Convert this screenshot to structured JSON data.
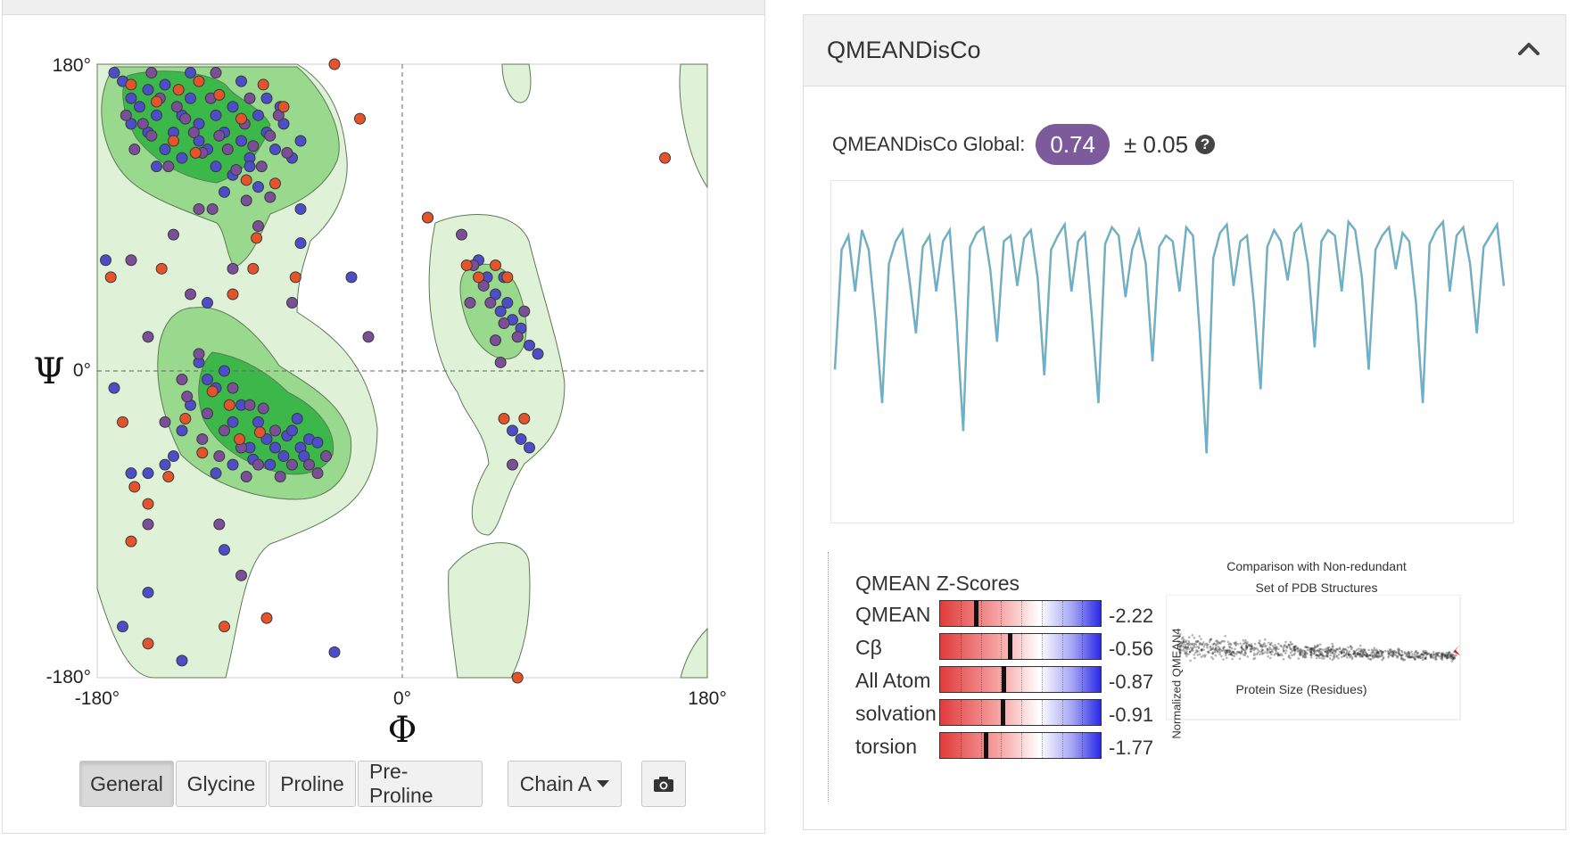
{
  "ramachandran": {
    "x_axis_symbol": "Φ",
    "y_axis_symbol": "Ψ",
    "x_ticks": [
      "-180°",
      "0°",
      "180°"
    ],
    "y_ticks": [
      "180°",
      "0°",
      "-180°"
    ],
    "colors": {
      "region_light": "#dff2d8",
      "region_mid": "#99d98d",
      "region_dark": "#3cb84a",
      "point_blue": "#4d4dc8",
      "point_purple": "#7a4f97",
      "point_orange": "#e5532b"
    },
    "buttons": [
      {
        "label": "General",
        "active": true
      },
      {
        "label": "Glycine",
        "active": false
      },
      {
        "label": "Proline",
        "active": false
      },
      {
        "label": "Pre-Proline",
        "active": false
      }
    ],
    "chain_dropdown": "Chain A",
    "camera_icon": "camera-icon"
  },
  "qmeandisco": {
    "panel_title": "QMEANDisCo",
    "collapse_icon": "chevron-up-icon",
    "global_label": "QMEANDisCo Global:",
    "global_value": "0.74",
    "global_error": "± 0.05",
    "help_icon": "question-circle-icon",
    "badge_color": "#7c5a9b"
  },
  "zscores": {
    "title": "QMEAN Z-Scores",
    "items": [
      {
        "label": "QMEAN",
        "value": "-2.22",
        "z": -2.22
      },
      {
        "label": "Cβ",
        "value": "-0.56",
        "z": -0.56
      },
      {
        "label": "All Atom",
        "value": "-0.87",
        "z": -0.87
      },
      {
        "label": "solvation",
        "value": "-0.91",
        "z": -0.91
      },
      {
        "label": "torsion",
        "value": "-1.77",
        "z": -1.77
      }
    ]
  },
  "comparison": {
    "title_line1": "Comparison with Non-redundant",
    "title_line2": "Set of PDB Structures",
    "xlabel": "Protein Size (Residues)",
    "ylabel": "Normalized QMEAN4"
  },
  "chart_data": [
    {
      "type": "scatter",
      "x_symbol": "Φ",
      "y_symbol": "Ψ",
      "xlim": [
        -180,
        180
      ],
      "ylim": [
        -180,
        180
      ],
      "grid": false,
      "series": [
        {
          "values": [
            [
              -165,
              170
            ],
            [
              -160,
              160
            ],
            [
              -155,
              155
            ],
            [
              -150,
              165
            ],
            [
              -145,
              150
            ],
            [
              -140,
              168
            ],
            [
              -135,
              140
            ],
            [
              -130,
              150
            ],
            [
              -125,
              160
            ],
            [
              -120,
              145
            ],
            [
              -115,
              130
            ],
            [
              -110,
              150
            ],
            [
              -105,
              140
            ],
            [
              -100,
              155
            ],
            [
              -95,
              135
            ],
            [
              -90,
              125
            ],
            [
              -85,
              150
            ],
            [
              -80,
              140
            ],
            [
              -75,
              130
            ],
            [
              -70,
              145
            ],
            [
              -65,
              125
            ],
            [
              -60,
              135
            ],
            [
              -150,
              140
            ],
            [
              -140,
              130
            ],
            [
              -130,
              125
            ],
            [
              -120,
              135
            ],
            [
              -110,
              120
            ],
            [
              -100,
              115
            ],
            [
              -90,
              120
            ],
            [
              -80,
              160
            ],
            [
              -160,
              145
            ],
            [
              -170,
              175
            ],
            [
              -125,
              175
            ],
            [
              -95,
              170
            ],
            [
              -72,
              155
            ],
            [
              -145,
              120
            ],
            [
              -105,
              105
            ],
            [
              -85,
              108
            ],
            [
              -62,
              -28
            ],
            [
              -68,
              -38
            ],
            [
              -75,
              -45
            ],
            [
              -80,
              -40
            ],
            [
              -70,
              -50
            ],
            [
              -60,
              -45
            ],
            [
              -65,
              -35
            ],
            [
              -85,
              -30
            ],
            [
              -90,
              -45
            ],
            [
              -95,
              -20
            ],
            [
              -100,
              -30
            ],
            [
              -110,
              -10
            ],
            [
              -120,
              5
            ],
            [
              -115,
              -5
            ],
            [
              -105,
              0
            ],
            [
              -125,
              -20
            ],
            [
              -135,
              -50
            ],
            [
              -130,
              -35
            ],
            [
              -55,
              -40
            ],
            [
              -58,
              -50
            ],
            [
              -50,
              -42
            ],
            [
              -78,
              -55
            ],
            [
              -88,
              -52
            ],
            [
              -100,
              -55
            ],
            [
              -110,
              -60
            ],
            [
              -140,
              -55
            ],
            [
              -150,
              -60
            ],
            [
              -160,
              -60
            ],
            [
              -115,
              40
            ],
            [
              -60,
              95
            ],
            [
              -30,
              55
            ],
            [
              -60,
              75
            ],
            [
              55,
              45
            ],
            [
              58,
              35
            ],
            [
              62,
              40
            ],
            [
              50,
              55
            ],
            [
              65,
              30
            ],
            [
              70,
              25
            ],
            [
              75,
              15
            ],
            [
              60,
              55
            ],
            [
              45,
              65
            ],
            [
              80,
              10
            ],
            [
              -170,
              -10
            ],
            [
              -165,
              -150
            ],
            [
              -130,
              -170
            ],
            [
              -40,
              -165
            ],
            [
              -150,
              -130
            ],
            [
              -175,
              65
            ],
            [
              65,
              -35
            ],
            [
              70,
              -40
            ],
            [
              75,
              -45
            ],
            [
              -105,
              -105
            ]
          ]
        },
        {
          "values": [
            [
              -163,
              150
            ],
            [
              -153,
              145
            ],
            [
              -143,
              160
            ],
            [
              -133,
              155
            ],
            [
              -123,
              140
            ],
            [
              -113,
              160
            ],
            [
              -103,
              130
            ],
            [
              -93,
              145
            ],
            [
              -83,
              120
            ],
            [
              -73,
              150
            ],
            [
              -158,
              130
            ],
            [
              -148,
              138
            ],
            [
              -138,
              120
            ],
            [
              -128,
              148
            ],
            [
              -118,
              128
            ],
            [
              -108,
              138
            ],
            [
              -98,
              118
            ],
            [
              -88,
              132
            ],
            [
              -78,
              138
            ],
            [
              -68,
              128
            ],
            [
              -148,
              175
            ],
            [
              -110,
              175
            ],
            [
              -90,
              160
            ],
            [
              -112,
              95
            ],
            [
              -85,
              85
            ],
            [
              -125,
              45
            ],
            [
              -100,
              60
            ],
            [
              -140,
              -30
            ],
            [
              -127,
              -15
            ],
            [
              -115,
              -25
            ],
            [
              -105,
              -35
            ],
            [
              -95,
              -45
            ],
            [
              -85,
              -55
            ],
            [
              -75,
              -35
            ],
            [
              -65,
              -55
            ],
            [
              -118,
              -40
            ],
            [
              -108,
              -50
            ],
            [
              -92,
              -62
            ],
            [
              -72,
              -62
            ],
            [
              -82,
              -22
            ],
            [
              -120,
              10
            ],
            [
              -130,
              -5
            ],
            [
              -100,
              -10
            ],
            [
              -90,
              -20
            ],
            [
              -150,
              -90
            ],
            [
              -95,
              -120
            ],
            [
              -20,
              20
            ],
            [
              15,
              90
            ],
            [
              35,
              80
            ],
            [
              42,
              62
            ],
            [
              52,
              40
            ],
            [
              60,
              28
            ],
            [
              68,
              20
            ],
            [
              55,
              18
            ],
            [
              48,
              50
            ],
            [
              72,
              35
            ],
            [
              40,
              40
            ],
            [
              58,
              5
            ],
            [
              65,
              -55
            ],
            [
              -160,
              65
            ],
            [
              -120,
              95
            ],
            [
              -78,
              102
            ],
            [
              -108,
              -90
            ],
            [
              -50,
              -60
            ],
            [
              -45,
              -50
            ],
            [
              -55,
              -55
            ],
            [
              -92,
              100
            ],
            [
              -65,
              40
            ],
            [
              -150,
              20
            ],
            [
              -135,
              80
            ]
          ]
        },
        {
          "values": [
            [
              -160,
              168
            ],
            [
              -145,
              158
            ],
            [
              -132,
              165
            ],
            [
              -120,
              170
            ],
            [
              -108,
              162
            ],
            [
              -95,
              148
            ],
            [
              -82,
              168
            ],
            [
              -70,
              155
            ],
            [
              -135,
              135
            ],
            [
              -122,
              128
            ],
            [
              -92,
              112
            ],
            [
              -75,
              110
            ],
            [
              -88,
              60
            ],
            [
              -112,
              -12
            ],
            [
              -128,
              -28
            ],
            [
              -102,
              -20
            ],
            [
              -118,
              -48
            ],
            [
              -96,
              -40
            ],
            [
              -84,
              -36
            ],
            [
              -138,
              -62
            ],
            [
              -165,
              -30
            ],
            [
              -172,
              55
            ],
            [
              -160,
              -100
            ],
            [
              -150,
              -160
            ],
            [
              -80,
              -145
            ],
            [
              -105,
              -150
            ],
            [
              -158,
              -68
            ],
            [
              -100,
              45
            ],
            [
              -86,
              78
            ],
            [
              -142,
              60
            ],
            [
              -63,
              55
            ],
            [
              -25,
              148
            ],
            [
              15,
              90
            ],
            [
              38,
              62
            ],
            [
              55,
              62
            ],
            [
              45,
              55
            ],
            [
              62,
              55
            ],
            [
              72,
              -28
            ],
            [
              60,
              -28
            ],
            [
              155,
              125
            ],
            [
              68,
              -180
            ],
            [
              -40,
              180
            ],
            [
              -150,
              -78
            ]
          ]
        }
      ]
    },
    {
      "type": "line",
      "ylim": [
        0,
        1
      ],
      "series": [
        {
          "values": [
            0.42,
            0.85,
            0.9,
            0.7,
            0.92,
            0.85,
            0.6,
            0.3,
            0.8,
            0.88,
            0.92,
            0.75,
            0.55,
            0.86,
            0.9,
            0.7,
            0.88,
            0.92,
            0.6,
            0.2,
            0.86,
            0.91,
            0.93,
            0.78,
            0.52,
            0.88,
            0.9,
            0.72,
            0.89,
            0.92,
            0.75,
            0.4,
            0.85,
            0.9,
            0.94,
            0.7,
            0.88,
            0.91,
            0.62,
            0.3,
            0.87,
            0.93,
            0.9,
            0.68,
            0.85,
            0.92,
            0.8,
            0.45,
            0.86,
            0.9,
            0.88,
            0.7,
            0.93,
            0.9,
            0.55,
            0.12,
            0.82,
            0.91,
            0.94,
            0.72,
            0.88,
            0.9,
            0.66,
            0.35,
            0.86,
            0.92,
            0.88,
            0.74,
            0.91,
            0.94,
            0.8,
            0.5,
            0.88,
            0.92,
            0.9,
            0.7,
            0.95,
            0.92,
            0.75,
            0.42,
            0.85,
            0.9,
            0.93,
            0.78,
            0.91,
            0.88,
            0.66,
            0.3,
            0.87,
            0.92,
            0.95,
            0.7,
            0.9,
            0.93,
            0.8,
            0.55,
            0.86,
            0.9,
            0.94,
            0.72
          ]
        }
      ]
    }
  ]
}
